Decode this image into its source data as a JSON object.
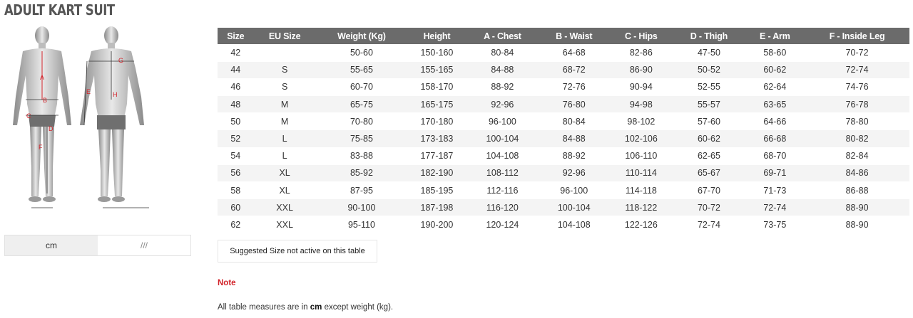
{
  "page": {
    "title": "ADULT KART SUIT"
  },
  "figure": {
    "markers": [
      "A",
      "B",
      "C",
      "D",
      "F",
      "G",
      "E",
      "H"
    ]
  },
  "units": {
    "active": "cm",
    "inactive": "///"
  },
  "table": {
    "headers": [
      "Size",
      "EU Size",
      "Weight (Kg)",
      "Height",
      "A - Chest",
      "B - Waist",
      "C - Hips",
      "D - Thigh",
      "E - Arm",
      "F - Inside Leg"
    ],
    "rows": [
      [
        "42",
        "",
        "50-60",
        "150-160",
        "80-84",
        "64-68",
        "82-86",
        "47-50",
        "58-60",
        "70-72"
      ],
      [
        "44",
        "S",
        "55-65",
        "155-165",
        "84-88",
        "68-72",
        "86-90",
        "50-52",
        "60-62",
        "72-74"
      ],
      [
        "46",
        "S",
        "60-70",
        "158-170",
        "88-92",
        "72-76",
        "90-94",
        "52-55",
        "62-64",
        "74-76"
      ],
      [
        "48",
        "M",
        "65-75",
        "165-175",
        "92-96",
        "76-80",
        "94-98",
        "55-57",
        "63-65",
        "76-78"
      ],
      [
        "50",
        "M",
        "70-80",
        "170-180",
        "96-100",
        "80-84",
        "98-102",
        "57-60",
        "64-66",
        "78-80"
      ],
      [
        "52",
        "L",
        "75-85",
        "173-183",
        "100-104",
        "84-88",
        "102-106",
        "60-62",
        "66-68",
        "80-82"
      ],
      [
        "54",
        "L",
        "83-88",
        "177-187",
        "104-108",
        "88-92",
        "106-110",
        "62-65",
        "68-70",
        "82-84"
      ],
      [
        "56",
        "XL",
        "85-92",
        "182-190",
        "108-112",
        "92-96",
        "110-114",
        "65-67",
        "69-71",
        "84-86"
      ],
      [
        "58",
        "XL",
        "87-95",
        "185-195",
        "112-116",
        "96-100",
        "114-118",
        "67-70",
        "71-73",
        "86-88"
      ],
      [
        "60",
        "XXL",
        "90-100",
        "187-198",
        "116-120",
        "100-104",
        "118-122",
        "70-72",
        "72-74",
        "88-90"
      ],
      [
        "62",
        "XXL",
        "95-110",
        "190-200",
        "120-124",
        "104-108",
        "122-126",
        "72-74",
        "73-75",
        "88-90"
      ]
    ]
  },
  "suggested": {
    "label": "Suggested Size not active on this table"
  },
  "note": {
    "title": "Note",
    "text_before": "All table measures are in ",
    "unit": "cm",
    "text_after": " except weight (kg)."
  },
  "colors": {
    "header_bg": "#6b6b6b",
    "accent_red": "#d2232a",
    "row_alt": "#f4f4f4"
  }
}
